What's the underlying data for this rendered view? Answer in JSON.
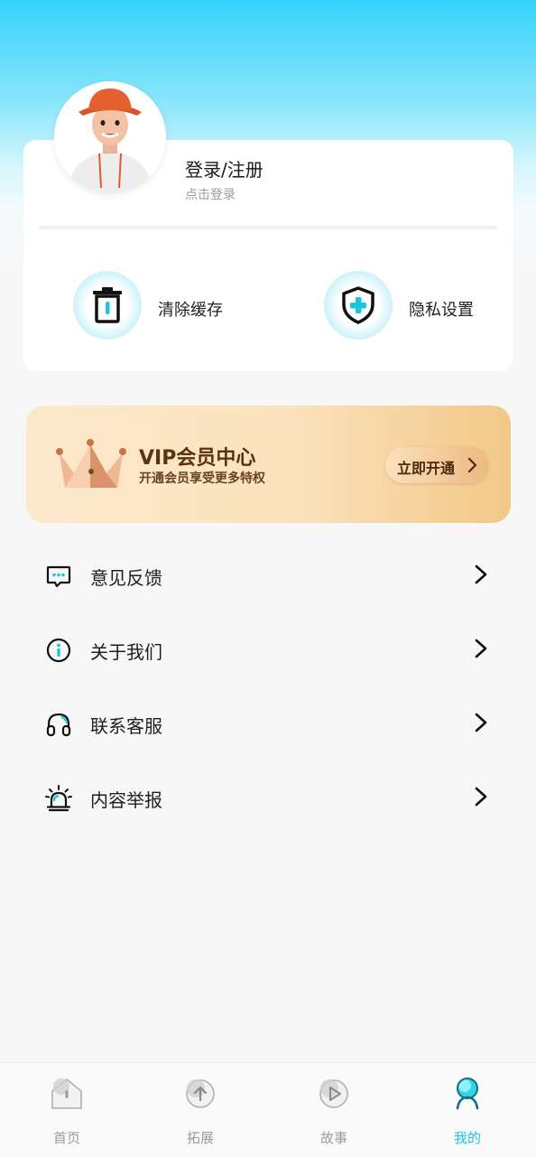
{
  "profile": {
    "login_title": "登录/注册",
    "login_subtitle": "点击登录"
  },
  "quick_actions": [
    {
      "label": "清除缓存",
      "icon": "trash-icon"
    },
    {
      "label": "隐私设置",
      "icon": "shield-plus-icon"
    }
  ],
  "vip": {
    "title": "VIP会员中心",
    "subtitle": "开通会员享受更多特权",
    "button_label": "立即开通",
    "icon": "crown-icon"
  },
  "menu": [
    {
      "label": "意见反馈",
      "icon": "feedback-icon"
    },
    {
      "label": "关于我们",
      "icon": "info-icon"
    },
    {
      "label": "联系客服",
      "icon": "headset-icon"
    },
    {
      "label": "内容举报",
      "icon": "alarm-icon"
    }
  ],
  "tabs": [
    {
      "label": "首页",
      "icon": "home-icon",
      "active": false
    },
    {
      "label": "拓展",
      "icon": "expand-icon",
      "active": false
    },
    {
      "label": "故事",
      "icon": "story-play-icon",
      "active": false
    },
    {
      "label": "我的",
      "icon": "profile-icon",
      "active": true
    }
  ],
  "colors": {
    "accent": "#19c6dc",
    "header_gradient_top": "#33d2fb",
    "vip_text": "#5a3412"
  }
}
